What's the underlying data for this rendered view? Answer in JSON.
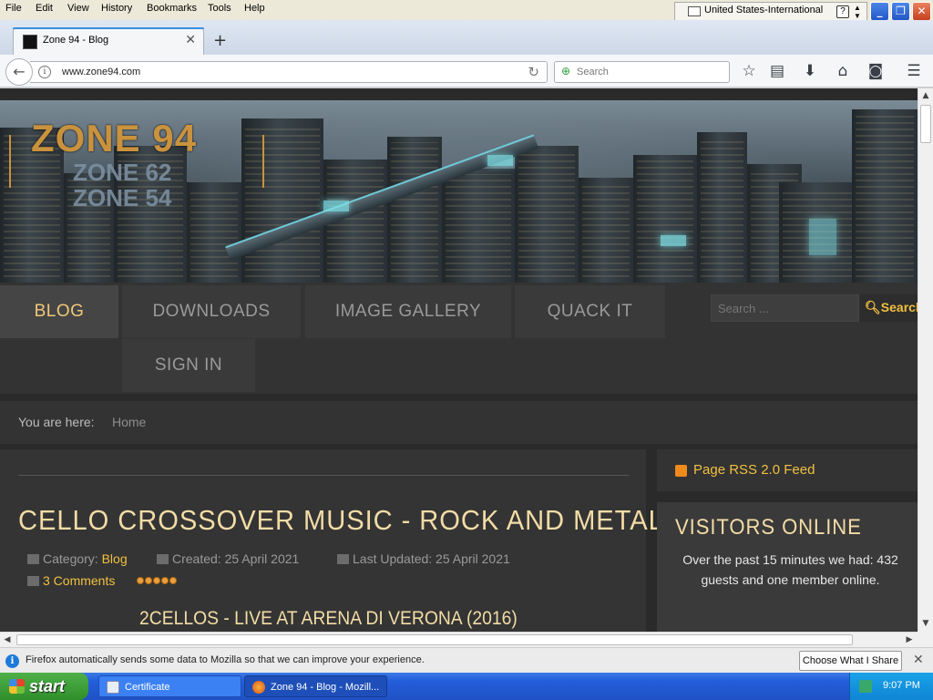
{
  "menubar": {
    "items": [
      "File",
      "Edit",
      "View",
      "History",
      "Bookmarks",
      "Tools",
      "Help"
    ],
    "language": "United States-International",
    "help_glyph": "?"
  },
  "tabs": {
    "active_title": "Zone 94 - Blog",
    "close_glyph": "✕",
    "new_tab_glyph": "+"
  },
  "navbar": {
    "url": "www.zone94.com",
    "search_placeholder": "Search"
  },
  "site": {
    "logo_main": "ZONE 94",
    "logo_sub1": "ZONE 62",
    "logo_sub2": "ZONE 54",
    "nav": [
      "BLOG",
      "DOWNLOADS",
      "IMAGE GALLERY",
      "QUACK IT",
      "SIGN IN"
    ],
    "search_placeholder": "Search ...",
    "search_button": "Search",
    "breadcrumb_label": "You are here:",
    "breadcrumb_home": "Home",
    "accent_color": "#f0c040"
  },
  "article": {
    "title": "CELLO CROSSOVER MUSIC - ROCK AND METAL",
    "category_label": "Category:",
    "category": "Blog",
    "created": "Created: 25 April 2021",
    "updated": "Last Updated: 25 April 2021",
    "comments": "3 Comments",
    "rating_stars": 5,
    "subtitle": "2CELLOS - LIVE AT ARENA DI VERONA (2016)"
  },
  "sidebar": {
    "rss": "Page RSS 2.0 Feed",
    "visitors_title": "VISITORS ONLINE",
    "visitors_text": "Over the past 15 minutes we had: 432 guests and one member online."
  },
  "notification": {
    "text": "Firefox automatically sends some data to Mozilla so that we can improve your experience.",
    "button": "Choose What I Share"
  },
  "taskbar": {
    "start": "start",
    "tasks": [
      "Certificate",
      "Zone 94 - Blog - Mozill..."
    ],
    "clock": "9:07 PM"
  }
}
